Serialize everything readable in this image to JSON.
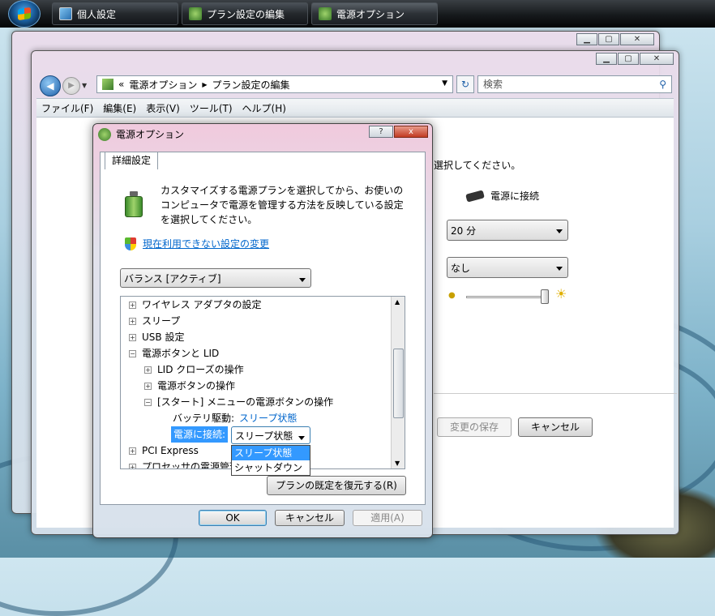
{
  "taskbar": {
    "buttons": [
      {
        "label": "個人設定",
        "icon": "display-icon"
      },
      {
        "label": "プラン設定の編集",
        "icon": "power-plug-icon"
      },
      {
        "label": "電源オプション",
        "icon": "power-plug-icon"
      }
    ]
  },
  "back_window": {
    "address_path": [
      "電源オプション",
      "プラン設定の編集"
    ],
    "address_prefix": "«",
    "search_placeholder": "検索",
    "menu": [
      "ファイル(F)",
      "編集(E)",
      "表示(V)",
      "ツール(T)",
      "ヘルプ(H)"
    ],
    "intro_text_tail": "選択してください。",
    "column_header": "電源に接続",
    "select_1": "20 分",
    "select_2": "なし",
    "save_button": "変更の保存",
    "cancel_button": "キャンセル",
    "brightness_percent": 100
  },
  "dialog": {
    "title": "電源オプション",
    "help_button": "?",
    "close_button": "x",
    "tab": "詳細設定",
    "description": "カスタマイズする電源プランを選択してから、お使いのコンピュータで電源を管理する方法を反映している設定を選択してください。",
    "change_link": "現在利用できない設定の変更",
    "plan_select": "バランス [アクティブ]",
    "tree": [
      {
        "label": "ワイヤレス アダプタの設定",
        "expander": "+",
        "level": 0
      },
      {
        "label": "スリープ",
        "expander": "+",
        "level": 0
      },
      {
        "label": "USB 設定",
        "expander": "+",
        "level": 0
      },
      {
        "label": "電源ボタンと LID",
        "expander": "−",
        "level": 0
      },
      {
        "label": "LID クローズの操作",
        "expander": "+",
        "level": 1
      },
      {
        "label": "電源ボタンの操作",
        "expander": "+",
        "level": 1
      },
      {
        "label": "[スタート] メニューの電源ボタンの操作",
        "expander": "−",
        "level": 1
      },
      {
        "label": "PCI Express",
        "expander": "+",
        "level": 0
      },
      {
        "label": "プロセッサの電源管理",
        "expander": "+",
        "level": 0
      }
    ],
    "battery_label": "バッテリ駆動:",
    "battery_value": "スリープ状態",
    "plugged_label": "電源に接続:",
    "plugged_value": "スリープ状態",
    "dropdown_options": [
      "スリープ状態",
      "シャットダウン"
    ],
    "restore_button": "プランの既定を復元する(R)",
    "ok_button": "OK",
    "cancel_button": "キャンセル",
    "apply_button": "適用(A)"
  }
}
